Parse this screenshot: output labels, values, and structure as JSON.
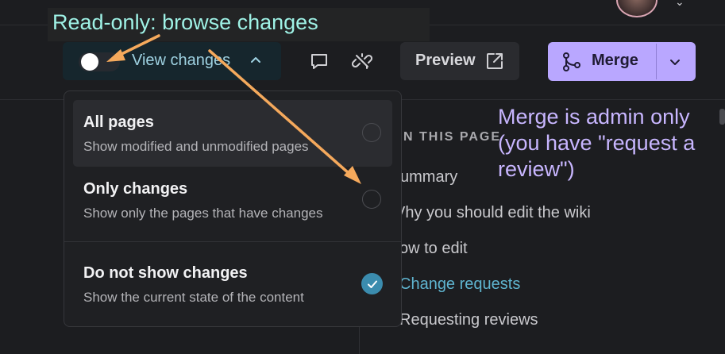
{
  "annotations": {
    "top": "Read-only: browse changes",
    "right": "Merge is admin only\n(you have \"request a\nreview\")"
  },
  "toolbar": {
    "view_toggle_on": false,
    "view_label": "View changes",
    "preview_label": "Preview",
    "merge_label": "Merge"
  },
  "dropdown": {
    "options": [
      {
        "title": "All pages",
        "desc": "Show modified and unmodified pages",
        "selected": false
      },
      {
        "title": "Only changes",
        "desc": "Show only the pages that have changes",
        "selected": false
      },
      {
        "title": "Do not show changes",
        "desc": "Show the current state of the content",
        "selected": true
      }
    ]
  },
  "toc": {
    "heading": "N THIS PAGE",
    "items": [
      "ummary",
      "Vhy you should edit the wiki",
      "ow to edit",
      "Change requests",
      "Requesting reviews"
    ],
    "active_index": 3
  },
  "icons": {
    "view_chevron": "chevron-up-icon",
    "comment": "comment-icon",
    "unlink": "unlink-icon",
    "preview": "external-link-icon",
    "merge": "git-merge-icon",
    "merge_menu": "chevron-down-icon",
    "checked": "check-icon",
    "avatar_menu": "chevron-down-icon"
  },
  "colors": {
    "merge_button": "#b9a7ff",
    "accent": "#3b8cae",
    "annotation_arrow": "#f5a95c",
    "annotation_top": "#9ff2e6",
    "annotation_right": "#c8b6ff"
  }
}
